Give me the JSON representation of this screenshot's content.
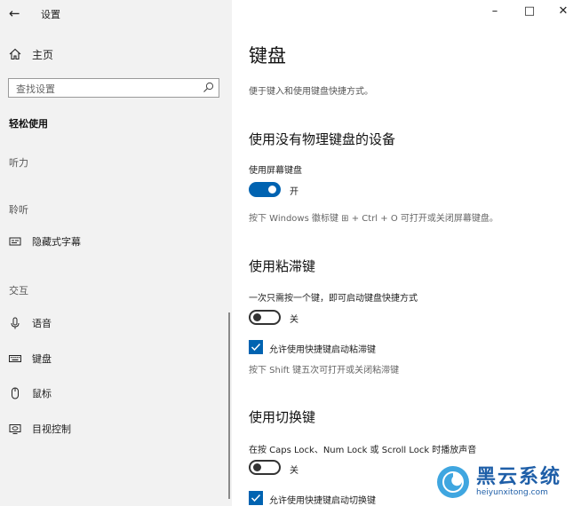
{
  "window": {
    "title": "设置",
    "controls": {
      "minimize": "–",
      "maximize": "□",
      "close": "✕"
    }
  },
  "sidebar": {
    "home_label": "主页",
    "search_placeholder": "查找设置",
    "category": "轻松使用",
    "groups": {
      "hearing": "听力",
      "listening": "聆听",
      "interaction": "交互"
    },
    "items": {
      "captions": "隐藏式字幕",
      "speech": "语音",
      "keyboard": "键盘",
      "mouse": "鼠标",
      "eye_control": "目视控制"
    }
  },
  "main": {
    "title": "键盘",
    "description": "便于键入和使用键盘快捷方式。",
    "osk": {
      "section_title": "使用没有物理键盘的设备",
      "setting_label": "使用屏幕键盘",
      "toggle_on": true,
      "toggle_state": "开",
      "hint": "按下 Windows 徽标键 ⊞ + Ctrl + O 可打开或关闭屏幕键盘。"
    },
    "sticky": {
      "section_title": "使用粘滞键",
      "setting_label": "一次只需按一个键，即可启动键盘快捷方式",
      "toggle_on": false,
      "toggle_state": "关",
      "checkbox_checked": true,
      "checkbox_label": "允许使用快捷键启动粘滞键",
      "hint": "按下 Shift 键五次可打开或关闭粘滞键"
    },
    "toggle_keys": {
      "section_title": "使用切换键",
      "setting_label": "在按 Caps Lock、Num Lock 或 Scroll Lock 时播放声音",
      "toggle_on": false,
      "toggle_state": "关",
      "checkbox_checked": true,
      "checkbox_label": "允许使用快捷键启动切换键"
    }
  },
  "watermark": {
    "name": "黑云系统",
    "url": "heiyunxitong.com"
  },
  "colors": {
    "accent": "#0063b1",
    "sidebar_bg": "#f2f2f2"
  }
}
